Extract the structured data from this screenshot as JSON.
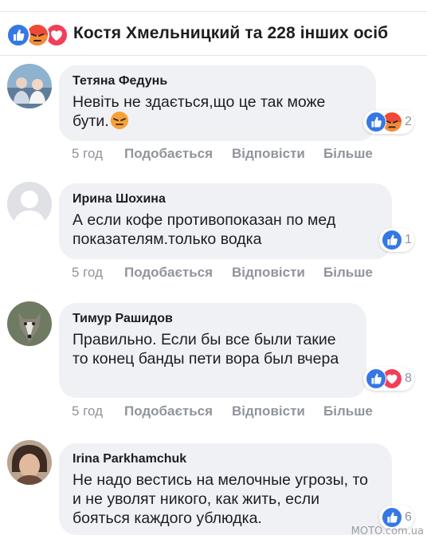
{
  "header": {
    "summary": "Костя Хмельницкий та 228 інших осіб",
    "reaction_icons": [
      "like-icon",
      "angry-icon",
      "love-icon"
    ]
  },
  "colors": {
    "like": "#3578e5",
    "angry": "#f05a3a",
    "love": "#f33e58",
    "meta_text": "#90949c",
    "bubble": "#f0f1f4"
  },
  "comments": [
    {
      "author": "Тетяна Федунь",
      "text": "Невіть не здається,що це так може бути.",
      "emoji": "angry-face-emoji",
      "time": "5 год",
      "like": "Подобається",
      "reply": "Відповісти",
      "more": "Більше",
      "reactions": [
        "like-icon",
        "angry-icon"
      ],
      "reaction_count": "2"
    },
    {
      "author": "Ирина Шохина",
      "text": "А если кофе противопоказан по мед показателям.только водка",
      "time": "5 год",
      "like": "Подобається",
      "reply": "Відповісти",
      "more": "Більше",
      "reactions": [
        "like-icon"
      ],
      "reaction_count": "1"
    },
    {
      "author": "Тимур Рашидов",
      "text": "Правильно. Если бы все были такие то конец банды пети вора был вчера",
      "time": "5 год",
      "like": "Подобається",
      "reply": "Відповісти",
      "more": "Більше",
      "reactions": [
        "like-icon",
        "love-icon"
      ],
      "reaction_count": "8"
    },
    {
      "author": "Irina Parkhamchuk",
      "text": "Не надо вестись на мелочные угрозы, то и не уволят никого, как жить, если бояться каждого ублюдка.",
      "reactions": [
        "like-icon"
      ],
      "reaction_count": "6"
    }
  ],
  "watermark": "MOTO.com.ua"
}
